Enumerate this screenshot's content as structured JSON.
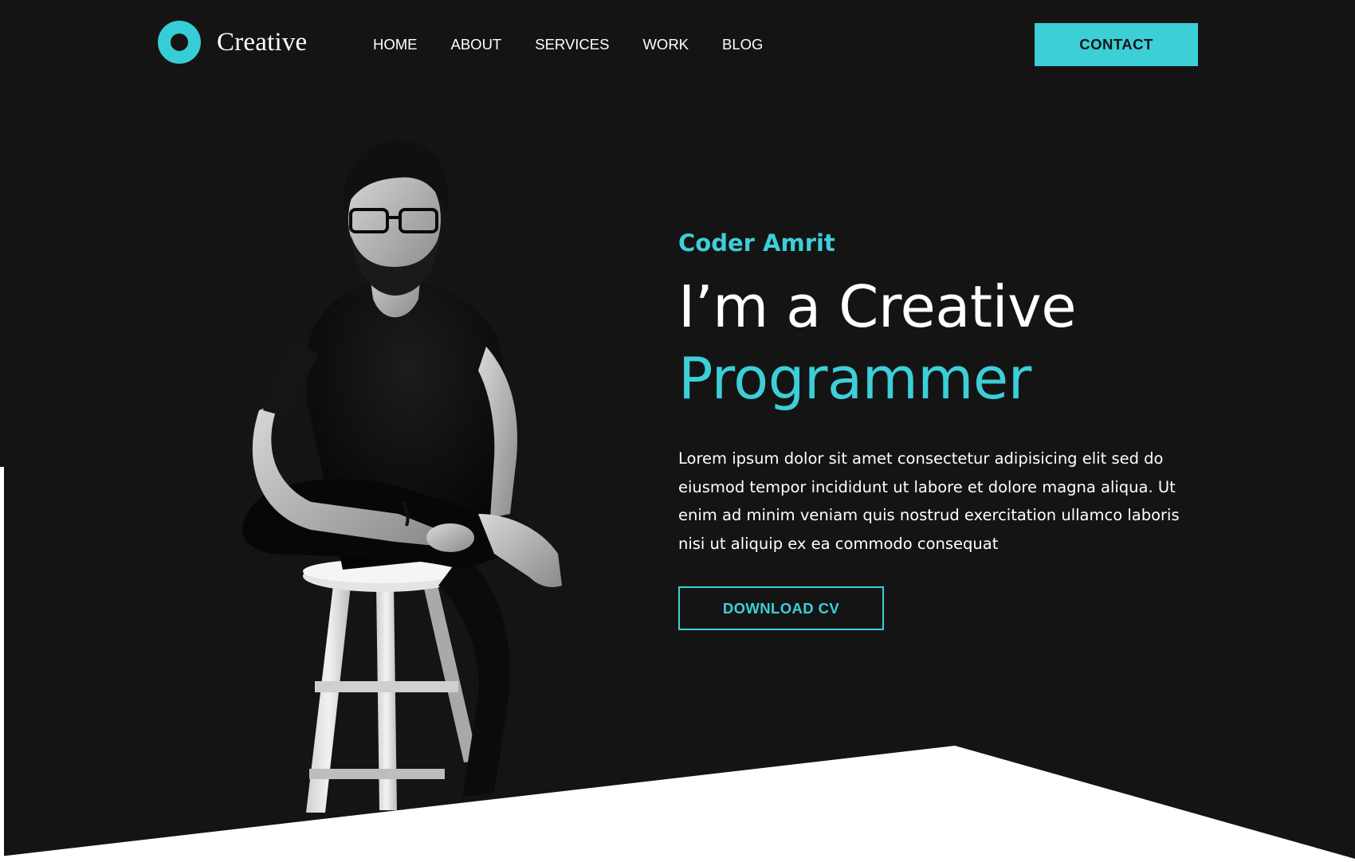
{
  "brand": {
    "name": "Creative"
  },
  "nav": {
    "items": [
      {
        "label": "HOME"
      },
      {
        "label": "ABOUT"
      },
      {
        "label": "SERVICES"
      },
      {
        "label": "WORK"
      },
      {
        "label": "BLOG"
      }
    ]
  },
  "header": {
    "contact_label": "CONTACT"
  },
  "hero": {
    "subtitle": "Coder Amrit",
    "headline_line1": "I’m a Creative",
    "headline_line2": "Programmer",
    "intro": "Lorem ipsum dolor sit amet consectetur adipisicing elit sed do eiusmod tempor incididunt ut labore et dolore magna aliqua. Ut enim ad minim veniam quis nostrud exercitation ullamco laboris nisi ut aliquip ex ea commodo consequat",
    "download_label": "DOWNLOAD CV"
  },
  "colors": {
    "background": "#141414",
    "accent": "#3ccfd8",
    "text": "#ffffff",
    "wedge": "#ffffff"
  },
  "icons": {
    "logo": "ring-logo-icon"
  }
}
